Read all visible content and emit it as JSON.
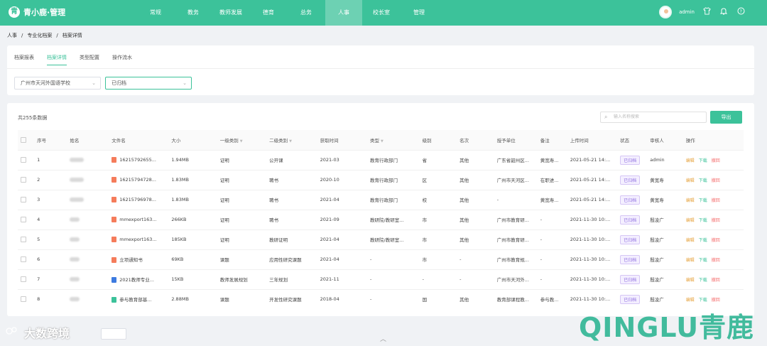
{
  "app": {
    "logo_mark": "青",
    "logo_text": "青小鹿·管理"
  },
  "nav": [
    {
      "label": "常规"
    },
    {
      "label": "教务"
    },
    {
      "label": "教师发展"
    },
    {
      "label": "德育"
    },
    {
      "label": "总务"
    },
    {
      "label": "人事",
      "active": true
    },
    {
      "label": "校长室"
    },
    {
      "label": "管理"
    }
  ],
  "user": {
    "name": "admin"
  },
  "icons": [
    "shirt-icon",
    "bell-icon",
    "help-icon"
  ],
  "breadcrumb": [
    "人事",
    "/",
    "专业化档案",
    "/",
    "档案详情"
  ],
  "tabs": [
    "档案报表",
    "档案详情",
    "类型配置",
    "操作流水"
  ],
  "active_tab": 1,
  "filters": {
    "school": "广州市天河外国语学校",
    "status": "已归档"
  },
  "count_text": "共255条数据",
  "search": {
    "placeholder": "输入名称搜索"
  },
  "export_label": "导出",
  "columns": [
    "序号",
    "姓名",
    "文件名",
    "大小",
    "一级类别",
    "二级类别",
    "获取时间",
    "类型",
    "级别",
    "名次",
    "授予单位",
    "备注",
    "上传时间",
    "状态",
    "审核人",
    "操作"
  ],
  "rows": [
    {
      "no": "1",
      "file": "16215792655...",
      "size": "1.94MB",
      "c1": "证明",
      "c2": "公开课",
      "time": "2021-03",
      "type": "教育行政部门",
      "level": "省",
      "rank": "其他",
      "org": "广东省韶州区...",
      "note": "黄宽寿...",
      "upload": "2021-05-21 14:...",
      "status": "已归档",
      "reviewer": "admin",
      "ficon": "#f57c5b"
    },
    {
      "no": "2",
      "file": "16215794728...",
      "size": "1.83MB",
      "c1": "证明",
      "c2": "聘书",
      "time": "2020-10",
      "type": "教育行政部门",
      "level": "区",
      "rank": "其他",
      "org": "广州市天河区...",
      "note": "在职进...",
      "upload": "2021-05-21 14:...",
      "status": "已归档",
      "reviewer": "黄宽寿",
      "ficon": "#f57c5b"
    },
    {
      "no": "3",
      "file": "16215796978...",
      "size": "1.83MB",
      "c1": "证明",
      "c2": "聘书",
      "time": "2021-04",
      "type": "教育行政部门",
      "level": "校",
      "rank": "其他",
      "org": "-",
      "note": "黄宽寿...",
      "upload": "2021-05-21 14:...",
      "status": "已归档",
      "reviewer": "黄宽寿",
      "ficon": "#f57c5b"
    },
    {
      "no": "4",
      "file": "mmexport163...",
      "size": "266KB",
      "c1": "证明",
      "c2": "聘书",
      "time": "2021-09",
      "type": "教研院/教研室...",
      "level": "市",
      "rank": "其他",
      "org": "广州市教育研...",
      "note": "-",
      "upload": "2021-11-30 10:...",
      "status": "已归档",
      "reviewer": "殷凌广",
      "ficon": "#f57c5b"
    },
    {
      "no": "5",
      "file": "mmexport163...",
      "size": "185KB",
      "c1": "证明",
      "c2": "教研证明",
      "time": "2021-04",
      "type": "教研院/教研室...",
      "level": "市",
      "rank": "其他",
      "org": "广州市教育研...",
      "note": "-",
      "upload": "2021-11-30 10:...",
      "status": "已归档",
      "reviewer": "殷凌广",
      "ficon": "#f57c5b"
    },
    {
      "no": "6",
      "file": "立项通知书",
      "size": "69KB",
      "c1": "课题",
      "c2": "应用性研究课题",
      "time": "2021-04",
      "type": "-",
      "level": "市",
      "rank": "-",
      "org": "广州市教育规...",
      "note": "-",
      "upload": "2021-11-30 10:...",
      "status": "已归档",
      "reviewer": "殷凌广",
      "ficon": "#f57c5b"
    },
    {
      "no": "7",
      "file": "2021教师专业...",
      "size": "15KB",
      "c1": "教师发展规划",
      "c2": "三年规划",
      "time": "2021-11",
      "type": "-",
      "level": "-",
      "rank": "-",
      "org": "广州市天河外...",
      "note": "-",
      "upload": "2021-11-30 10:...",
      "status": "已归档",
      "reviewer": "殷凌广",
      "ficon": "#3d7be0"
    },
    {
      "no": "8",
      "file": "参与教育部基...",
      "size": "2.88MB",
      "c1": "课题",
      "c2": "开发性研究课题",
      "time": "2018-04",
      "type": "-",
      "level": "国",
      "rank": "其他",
      "org": "教育部课程教...",
      "note": "参与教...",
      "upload": "2021-11-30 10:...",
      "status": "已归档",
      "reviewer": "殷凌广",
      "ficon": "#3cc29a"
    }
  ],
  "actions": {
    "edit": "编辑",
    "download": "下载",
    "withdraw": "撤回"
  },
  "watermark": {
    "brand": "QINGLU青鹿",
    "left": "大数跨境"
  },
  "colors": {
    "primary": "#3cc29a",
    "status_purple": "#8e6ee0"
  }
}
